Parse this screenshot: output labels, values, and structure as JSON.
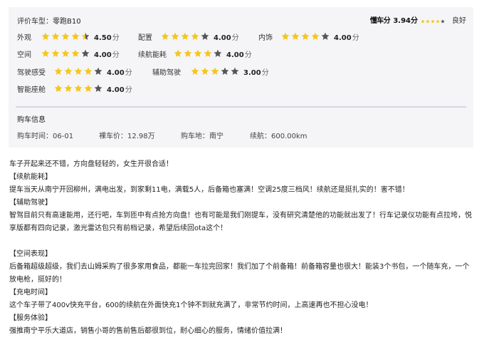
{
  "header": {
    "model_label": "评价车型：",
    "model_value": "零跑B10",
    "brand": "懂车分",
    "brand_score": "3.94分",
    "brand_stars": 4,
    "brand_word": "良好"
  },
  "ratings": [
    {
      "label": "外观",
      "stars": 4.5,
      "score": "4.50",
      "unit": "分"
    },
    {
      "label": "配置",
      "stars": 4,
      "score": "4.00",
      "unit": "分"
    },
    {
      "label": "内饰",
      "stars": 4,
      "score": "4.00",
      "unit": "分"
    },
    {
      "label": "空间",
      "stars": 4,
      "score": "4.00",
      "unit": "分"
    },
    {
      "label": "续航能耗",
      "stars": 4,
      "score": "4.00",
      "unit": "分"
    },
    {
      "label": "驾驶感受",
      "stars": 4,
      "score": "4.00",
      "unit": "分"
    },
    {
      "label": "辅助驾驶",
      "stars": 3,
      "score": "3.00",
      "unit": "分"
    },
    {
      "label": "智能座舱",
      "stars": 4,
      "score": "4.00",
      "unit": "分"
    }
  ],
  "purchase": {
    "title": "购车信息",
    "time": "购车时间：06-01",
    "price": "裸车价：12.98万",
    "place": "购车地：南宁",
    "range": "续航：600.00km"
  },
  "colors": {
    "star_filled": "#f5c61b",
    "star_empty": "#555555"
  },
  "review": [
    "车子开起来还不错，方向盘轻轻的，女生开很合适！",
    "【续航能耗】",
    "提车当天从南宁开回柳州，满电出发，到家剩11电，满载5人，后备箱也塞满！空调25度三档风！续航还是挺扎实的！害不错！",
    "【辅助驾驶】",
    "智驾目前只有高速能用，还行吧，车到匝中有点抢方向盘！也有可能是我们刚提车，没有研究清楚他的功能就出发了！行车记录仪功能有点拉垮，悦",
    "享版都有四向记录，激光雷达包只有前档记录，希望后续回ota这个！",
    "",
    "【空间表现】",
    "后备箱超级超级，我们去山姆采购了很多家用食品，都能一车拉完回家！我们加了个前备箱！前备箱容量也很大！能装3个书包，一个随车充，一个",
    "放电枪，挺好的！",
    "【充电时间】",
    "这个车子带了400v快充平台，600的续航在外面快充1个钟不到就充满了，非常节约时间，上高速再也不担心没电！",
    "【服务体验】",
    "强推南宁平乐大道店，销售小哥的售前售后都很到位，耐心细心的服务，情绪价值拉满！"
  ]
}
